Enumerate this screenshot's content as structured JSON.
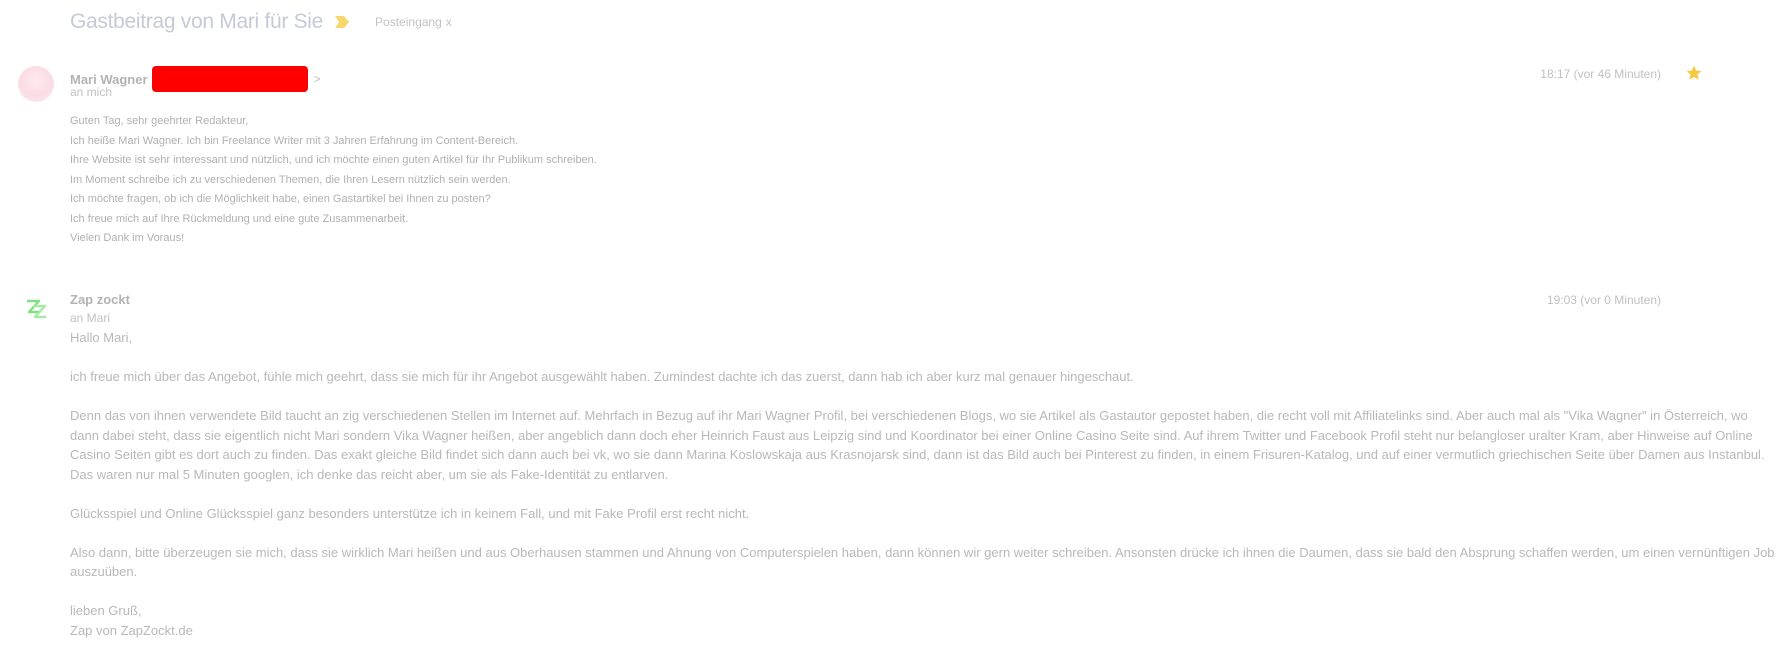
{
  "thread": {
    "subject": "Gastbeitrag von Mari für Sie",
    "label": "Posteingang",
    "label_remove": "x"
  },
  "messages": [
    {
      "sender_name": "Mari Wagner",
      "sender_suffix": ">",
      "recipient": "an mich",
      "timestamp": "18:17 (vor 46 Minuten)",
      "starred": true,
      "body_lines": [
        "Guten Tag, sehr geehrter Redakteur,",
        "Ich heiße Mari Wagner. Ich bin Freelance Writer mit 3 Jahren Erfahrung im Content-Bereich.",
        "Ihre Website ist sehr interessant und nützlich, und ich möchte einen guten Artikel für Ihr Publikum schreiben.",
        "Im Moment schreibe ich zu verschiedenen Themen, die Ihren Lesern nützlich sein werden.",
        "Ich möchte fragen, ob ich die Möglichkeit habe, einen Gastartikel bei Ihnen zu posten?",
        "Ich freue mich auf Ihre Rückmeldung und eine gute Zusammenarbeit.",
        "Vielen Dank im Voraus!"
      ]
    },
    {
      "sender_name": "Zap zockt",
      "recipient": "an Mari",
      "timestamp": "19:03 (vor 0 Minuten)",
      "greeting": "Hallo Mari,",
      "paragraphs": [
        "ich freue mich über das Angebot, fühle mich geehrt, dass sie mich für ihr Angebot ausgewählt haben. Zumindest dachte ich das zuerst, dann hab ich aber kurz mal genauer hingeschaut.",
        "Denn das von ihnen verwendete Bild taucht an zig verschiedenen Stellen im Internet auf. Mehrfach in Bezug auf ihr Mari Wagner Profil, bei verschiedenen Blogs, wo sie Artikel als Gastautor gepostet haben, die recht voll mit Affiliatelinks sind. Aber auch mal als \"Vika Wagner\" in Österreich, wo dann dabei steht, dass sie eigentlich nicht Mari sondern Vika Wagner heißen, aber angeblich dann doch eher Heinrich Faust aus Leipzig sind und Koordinator bei einer Online Casino Seite sind. Auf ihrem Twitter und Facebook Profil steht nur belangloser uralter Kram, aber Hinweise auf Online Casino Seiten gibt es dort auch zu finden. Das exakt gleiche Bild findet sich dann auch bei vk, wo sie dann Marina Koslowskaja aus Krasnojarsk sind, dann ist das Bild auch bei Pinterest zu finden, in einem Frisuren-Katalog, und auf einer vermutlich griechischen Seite über Damen aus Instanbul. Das waren nur mal 5 Minuten googlen, ich denke das reicht aber, um sie als Fake-Identität zu entlarven.",
        "Glücksspiel und Online Glücksspiel ganz besonders unterstütze ich in keinem Fall, und mit Fake Profil erst recht nicht.",
        "Also dann, bitte überzeugen sie mich, dass sie wirklich Mari heißen und aus Oberhausen stammen und Ahnung von Computerspielen haben, dann können wir gern weiter schreiben. Ansonsten drücke ich ihnen die Daumen, dass sie bald den Absprung schaffen werden, um einen vernünftigen Job auszuüben."
      ],
      "closing": "lieben Gruß,",
      "signature": "Zap von ZapZockt.de"
    }
  ],
  "icons": {
    "importance": "importance-marker-icon",
    "star": "star-icon",
    "avatar2": "zapzockt-logo-icon"
  },
  "colors": {
    "star": "#f7c842",
    "importance": "#f5d76e",
    "redaction": "#ff0000",
    "logo": "#7ee07e"
  }
}
